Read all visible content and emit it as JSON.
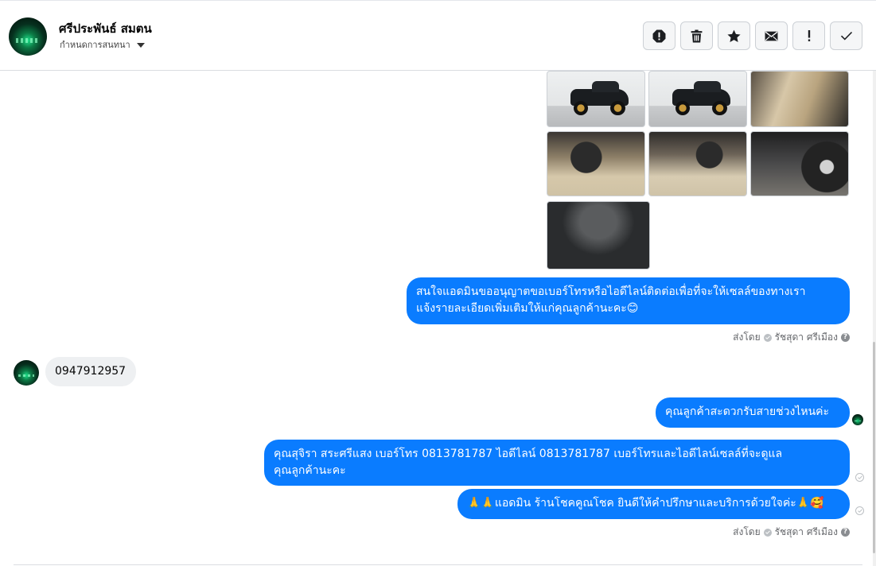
{
  "header": {
    "contact_name": "ศรีประพันธ์ สมตน",
    "conversation_settings": "กำหนดการสนทนา",
    "actions": [
      "report-icon",
      "trash-icon",
      "star-icon",
      "envelope-icon",
      "exclamation-icon",
      "check-icon"
    ]
  },
  "thread": {
    "images": [
      "truck-side-1",
      "truck-side-2",
      "door-interior",
      "dashboard-1",
      "dashboard-2",
      "steering-wheel",
      "engine-bay"
    ],
    "msg_outgoing_1": "สนใจแอดมินขออนุญาตขอเบอร์โทรหรือไอดีไลน์ติดต่อเพื่อที่จะให้เซลล์ของทางเรา",
    "msg_outgoing_1_line2": "แจ้งรายละเอียดเพิ่มเติมให้แก่คุณลูกค้านะคะ😊",
    "sent_by_label_1": "ส่งโดย",
    "sent_by_name_1": "รัชสุดา ศรีเมือง",
    "help_1": "?",
    "msg_incoming_1": "0947912957",
    "msg_outgoing_2": "คุณลูกค้าสะดวกรับสายช่วงไหนค่ะ",
    "msg_outgoing_3": "คุณสุจิรา สระศรีแสง     เบอร์โทร 0813781787  ไอดีไลน์ 0813781787   เบอร์โทรและไอดีไลน์เซลล์ที่จะดูแล",
    "msg_outgoing_3_line2": "คุณลูกค้านะคะ",
    "msg_outgoing_4": "🙏🙏แอดมิน ร้านโชคคูณโชค ยินดีให้คำปรึกษาและบริการด้วยใจค่ะ🙏🥰",
    "sent_by_label_2": "ส่งโดย",
    "sent_by_name_2": "รัชสุดา ศรีเมือง",
    "help_2": "?"
  },
  "colors": {
    "outgoing_bubble": "#0a7cff",
    "incoming_bubble": "#eef0f2",
    "meta_text": "#65676b"
  }
}
